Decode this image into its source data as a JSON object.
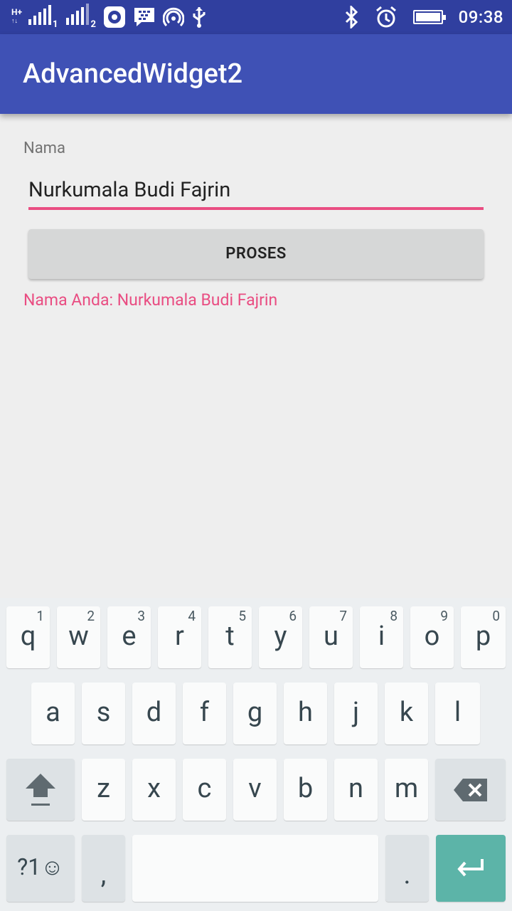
{
  "status_bar": {
    "network_type": "H+",
    "sim1_label": "1",
    "sim2_label": "2",
    "time": "09:38",
    "icons": [
      "signal-icon",
      "media-icon",
      "bbm-icon",
      "hotspot-icon",
      "usb-icon",
      "bluetooth-icon",
      "alarm-icon",
      "battery-icon"
    ]
  },
  "app_bar": {
    "title": "AdvancedWidget2"
  },
  "form": {
    "name_label": "Nama",
    "name_value": "Nurkumala Budi Fajrin",
    "process_button": "PROSES",
    "result_text": "Nama Anda: Nurkumala Budi Fajrin"
  },
  "keyboard": {
    "row1": [
      {
        "ch": "q",
        "num": "1"
      },
      {
        "ch": "w",
        "num": "2"
      },
      {
        "ch": "e",
        "num": "3"
      },
      {
        "ch": "r",
        "num": "4"
      },
      {
        "ch": "t",
        "num": "5"
      },
      {
        "ch": "y",
        "num": "6"
      },
      {
        "ch": "u",
        "num": "7"
      },
      {
        "ch": "i",
        "num": "8"
      },
      {
        "ch": "o",
        "num": "9"
      },
      {
        "ch": "p",
        "num": "0"
      }
    ],
    "row2": [
      "a",
      "s",
      "d",
      "f",
      "g",
      "h",
      "j",
      "k",
      "l"
    ],
    "row3": [
      "z",
      "x",
      "c",
      "v",
      "b",
      "n",
      "m"
    ],
    "symbols_label": "?1☺",
    "comma": ",",
    "period": ".",
    "colors": {
      "enter": "#5cb4a8",
      "accent": "#e94d82",
      "app_bar": "#3f51b5",
      "status_bar": "#303f9f"
    }
  }
}
